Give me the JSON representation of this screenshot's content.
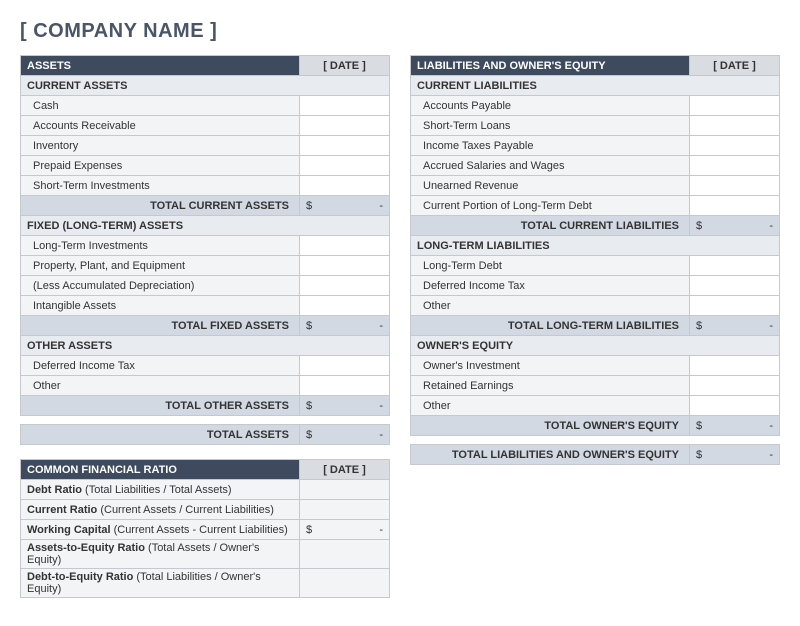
{
  "company_name": "[ COMPANY NAME ]",
  "date_placeholder": "[ DATE ]",
  "assets": {
    "header": "ASSETS",
    "sections": [
      {
        "title": "CURRENT ASSETS",
        "rows": [
          {
            "label": "Cash",
            "value": ""
          },
          {
            "label": "Accounts Receivable",
            "value": ""
          },
          {
            "label": "Inventory",
            "value": ""
          },
          {
            "label": "Prepaid Expenses",
            "value": ""
          },
          {
            "label": "Short-Term Investments",
            "value": ""
          }
        ],
        "total_label": "TOTAL CURRENT ASSETS",
        "total_currency": "$",
        "total_value": "-"
      },
      {
        "title": "FIXED (LONG-TERM) ASSETS",
        "rows": [
          {
            "label": "Long-Term Investments",
            "value": ""
          },
          {
            "label": "Property, Plant, and Equipment",
            "value": ""
          },
          {
            "label": "(Less Accumulated Depreciation)",
            "value": ""
          },
          {
            "label": "Intangible Assets",
            "value": ""
          }
        ],
        "total_label": "TOTAL FIXED ASSETS",
        "total_currency": "$",
        "total_value": "-"
      },
      {
        "title": "OTHER ASSETS",
        "rows": [
          {
            "label": "Deferred Income Tax",
            "value": ""
          },
          {
            "label": "Other",
            "value": ""
          }
        ],
        "total_label": "TOTAL OTHER ASSETS",
        "total_currency": "$",
        "total_value": "-"
      }
    ],
    "grand_total_label": "TOTAL ASSETS",
    "grand_total_currency": "$",
    "grand_total_value": "-"
  },
  "liabilities": {
    "header": "LIABILITIES AND OWNER'S EQUITY",
    "sections": [
      {
        "title": "CURRENT LIABILITIES",
        "rows": [
          {
            "label": "Accounts Payable",
            "value": ""
          },
          {
            "label": "Short-Term Loans",
            "value": ""
          },
          {
            "label": "Income Taxes Payable",
            "value": ""
          },
          {
            "label": "Accrued Salaries and Wages",
            "value": ""
          },
          {
            "label": "Unearned Revenue",
            "value": ""
          },
          {
            "label": "Current Portion of Long-Term Debt",
            "value": ""
          }
        ],
        "total_label": "TOTAL CURRENT LIABILITIES",
        "total_currency": "$",
        "total_value": "-"
      },
      {
        "title": "LONG-TERM LIABILITIES",
        "rows": [
          {
            "label": "Long-Term Debt",
            "value": ""
          },
          {
            "label": "Deferred Income Tax",
            "value": ""
          },
          {
            "label": "Other",
            "value": ""
          }
        ],
        "total_label": "TOTAL LONG-TERM LIABILITIES",
        "total_currency": "$",
        "total_value": "-"
      },
      {
        "title": "OWNER'S EQUITY",
        "rows": [
          {
            "label": "Owner's Investment",
            "value": ""
          },
          {
            "label": "Retained Earnings",
            "value": ""
          },
          {
            "label": "Other",
            "value": ""
          }
        ],
        "total_label": "TOTAL OWNER'S EQUITY",
        "total_currency": "$",
        "total_value": "-"
      }
    ],
    "grand_total_label": "TOTAL LIABILITIES AND OWNER'S EQUITY",
    "grand_total_currency": "$",
    "grand_total_value": "-"
  },
  "ratios": {
    "header": "COMMON FINANCIAL RATIO",
    "rows": [
      {
        "bold": "Debt Ratio",
        "light": " (Total Liabilities / Total Assets)",
        "currency": "",
        "value": ""
      },
      {
        "bold": "Current Ratio",
        "light": " (Current Assets / Current Liabilities)",
        "currency": "",
        "value": ""
      },
      {
        "bold": "Working Capital",
        "light": " (Current Assets - Current Liabilities)",
        "currency": "$",
        "value": "-"
      },
      {
        "bold": "Assets-to-Equity Ratio",
        "light": " (Total Assets / Owner's Equity)",
        "currency": "",
        "value": ""
      },
      {
        "bold": "Debt-to-Equity Ratio",
        "light": " (Total Liabilities / Owner's Equity)",
        "currency": "",
        "value": ""
      }
    ]
  }
}
